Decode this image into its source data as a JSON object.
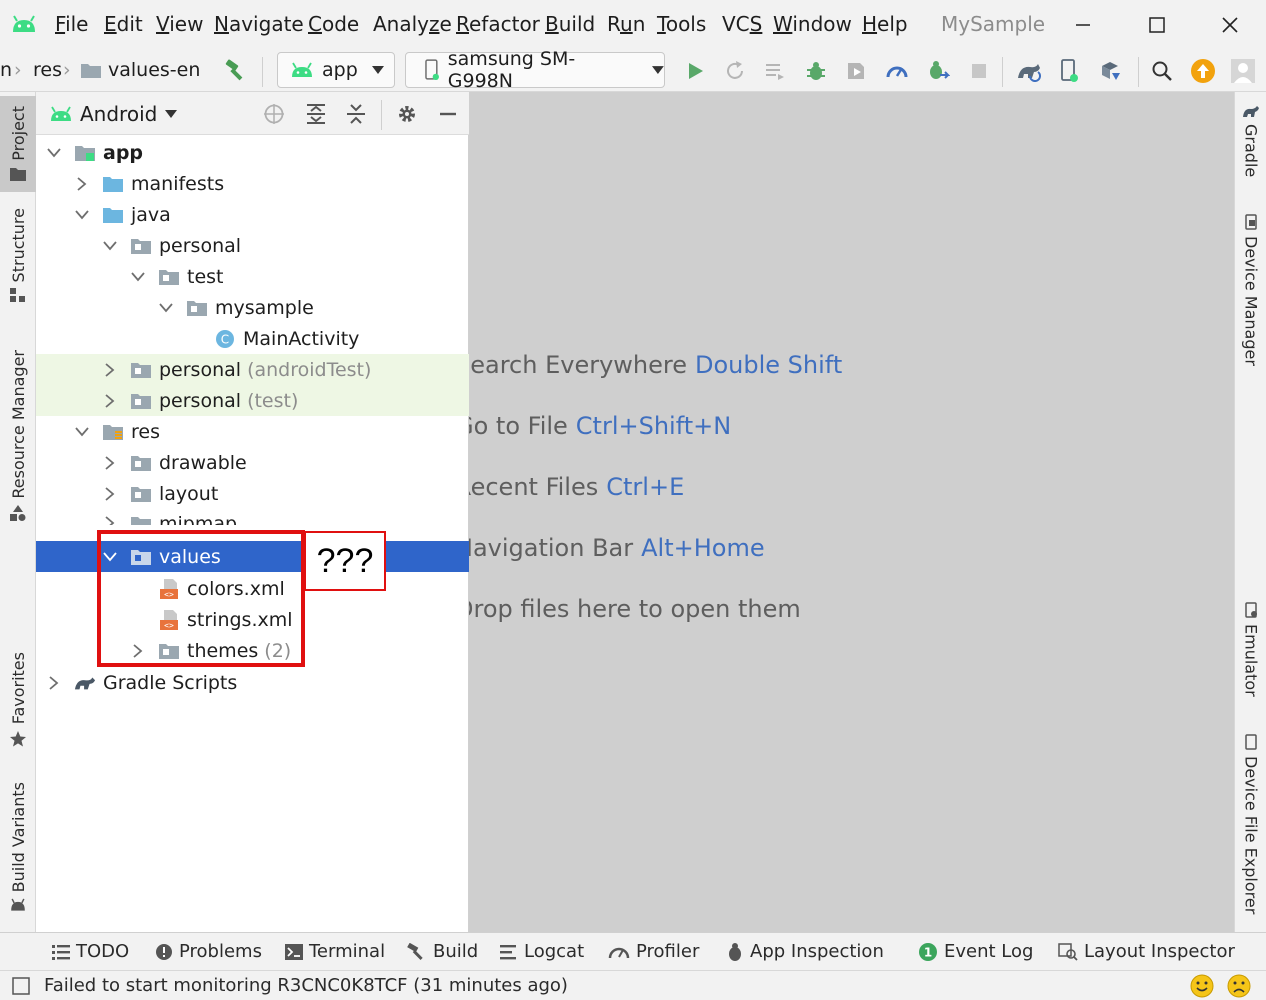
{
  "menubar": {
    "items": [
      {
        "mn": "F",
        "rest": "ile"
      },
      {
        "mn": "E",
        "rest": "dit"
      },
      {
        "mn": "V",
        "rest": "iew"
      },
      {
        "mn": "N",
        "rest": "avigate"
      },
      {
        "mn": "C",
        "rest": "ode"
      },
      {
        "mn": "",
        "rest": "Analy",
        "mn2": "z",
        "rest2": "e"
      },
      {
        "mn": "R",
        "rest": "efactor"
      },
      {
        "mn": "B",
        "rest": "uild"
      },
      {
        "mn": "",
        "rest": "R",
        "mn2": "u",
        "rest2": "n"
      },
      {
        "mn": "T",
        "rest": "ools"
      },
      {
        "mn": "",
        "rest": "VC",
        "mn2": "S",
        "rest2": ""
      },
      {
        "mn": "W",
        "rest": "indow"
      },
      {
        "mn": "H",
        "rest": "elp"
      }
    ],
    "app_title": "MySample"
  },
  "toolbar": {
    "breadcrumb": [
      "n",
      "res",
      "values-en"
    ],
    "module_combo": "app",
    "device_combo": "samsung SM-G998N"
  },
  "left_stripe": {
    "tabs": [
      "Project",
      "Structure",
      "Resource Manager",
      "Favorites",
      "Build Variants"
    ]
  },
  "right_stripe": {
    "tabs": [
      "Gradle",
      "Device Manager",
      "Emulator",
      "Device File Explorer"
    ]
  },
  "project_panel": {
    "view_mode": "Android",
    "tree": [
      {
        "label": "app",
        "hint": ""
      },
      {
        "label": "manifests",
        "hint": ""
      },
      {
        "label": "java",
        "hint": ""
      },
      {
        "label": "personal",
        "hint": ""
      },
      {
        "label": "test",
        "hint": ""
      },
      {
        "label": "mysample",
        "hint": ""
      },
      {
        "label": "MainActivity",
        "hint": ""
      },
      {
        "label": "personal",
        "hint": "(androidTest)"
      },
      {
        "label": "personal",
        "hint": "(test)"
      },
      {
        "label": "res",
        "hint": ""
      },
      {
        "label": "drawable",
        "hint": ""
      },
      {
        "label": "layout",
        "hint": ""
      },
      {
        "label": "mipmap",
        "hint": ""
      },
      {
        "label": "values",
        "hint": ""
      },
      {
        "label": "colors.xml",
        "hint": ""
      },
      {
        "label": "strings.xml",
        "hint": ""
      },
      {
        "label": "themes",
        "hint": "(2)"
      },
      {
        "label": "Gradle Scripts",
        "hint": ""
      }
    ]
  },
  "editor": {
    "tips": [
      {
        "text": "Search Everywhere",
        "key": "Double Shift"
      },
      {
        "text": "Go to File",
        "key": "Ctrl+Shift+N"
      },
      {
        "text": "Recent Files",
        "key": "Ctrl+E"
      },
      {
        "text": "Navigation Bar",
        "key": "Alt+Home"
      },
      {
        "text": "Drop files here to open them",
        "key": ""
      }
    ]
  },
  "bottom_bar": {
    "tabs": [
      "TODO",
      "Problems",
      "Terminal",
      "Build",
      "Logcat",
      "Profiler",
      "App Inspection",
      "Event Log",
      "Layout Inspector"
    ]
  },
  "status_bar": {
    "message": "Failed to start monitoring R3CNC0K8TCF (31 minutes ago)"
  },
  "annotation": {
    "label": "???"
  },
  "colors": {
    "selection": "#2f65ca",
    "android_green": "#3ddc84",
    "annotation_red": "#e01010",
    "link_blue": "#3f6fbf"
  }
}
